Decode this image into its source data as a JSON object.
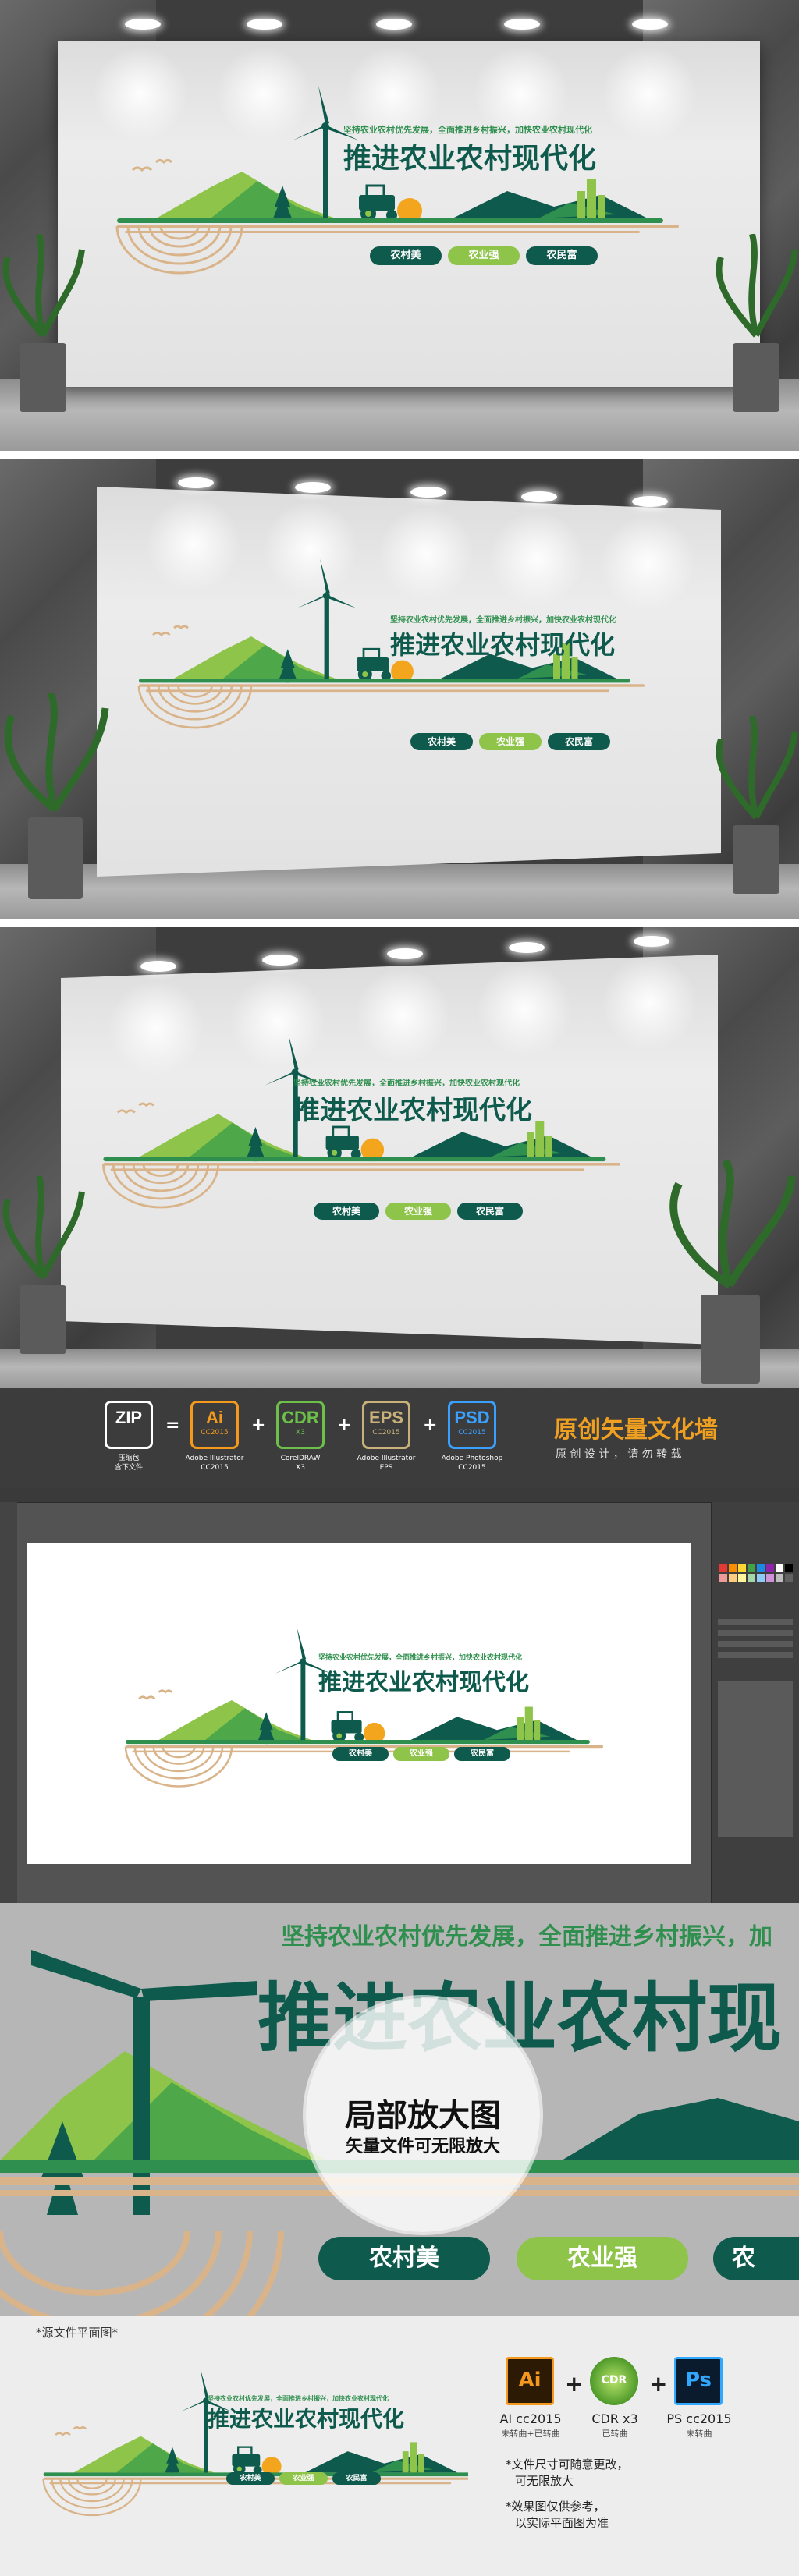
{
  "design": {
    "subtitle": "坚持农业农村优先发展，全面推进乡村振兴，加快农业农村现代化",
    "title": "推进农业农村现代化",
    "pills": [
      "农村美",
      "农业强",
      "农民富"
    ]
  },
  "formats_bar": {
    "items": [
      {
        "big": "ZIP",
        "small": "",
        "caption": "压缩包",
        "caption2": "含下文件"
      },
      {
        "big": "Ai",
        "small": "CC2015",
        "caption": "Adobe Illustrator",
        "caption2": "CC2015"
      },
      {
        "big": "CDR",
        "small": "X3",
        "caption": "CorelDRAW",
        "caption2": "X3"
      },
      {
        "big": "EPS",
        "small": "CC2015",
        "caption": "Adobe Illustrator",
        "caption2": "EPS"
      },
      {
        "big": "PSD",
        "small": "CC2015",
        "caption": "Adobe Photoshop",
        "caption2": "CC2015"
      }
    ],
    "ops": [
      "=",
      "+",
      "+",
      "+"
    ],
    "headline": "原创矢量文化墙",
    "tagline": "原 创 设 计 ， 请 勿 转 载"
  },
  "zoom": {
    "subtitle": "坚持农业农村优先发展，全面推进乡村振兴，加",
    "title": "推进农业农村现",
    "circle_title": "局部放大图",
    "circle_sub": "矢量文件可无限放大",
    "pills": [
      "农村美",
      "农业强",
      "农"
    ]
  },
  "plan": {
    "label": "*源文件平面图*",
    "software": [
      {
        "icon": "Ai",
        "name": "AI cc2015",
        "sub": "未转曲+已转曲"
      },
      {
        "icon": "CDR",
        "name": "CDR x3",
        "sub": "已转曲"
      },
      {
        "icon": "Ps",
        "name": "PS cc2015",
        "sub": "未转曲"
      }
    ],
    "notes": [
      "*文件尺寸可随意更改，",
      "可无限放大",
      "*效果图仅供参考，",
      "以实际平面图为准"
    ]
  },
  "colors": {
    "dark_green": "#0e5a4c",
    "mid_green": "#2f8f4e",
    "light_green": "#8ec449",
    "tan": "#d9b48a",
    "orange": "#f3a51d"
  }
}
